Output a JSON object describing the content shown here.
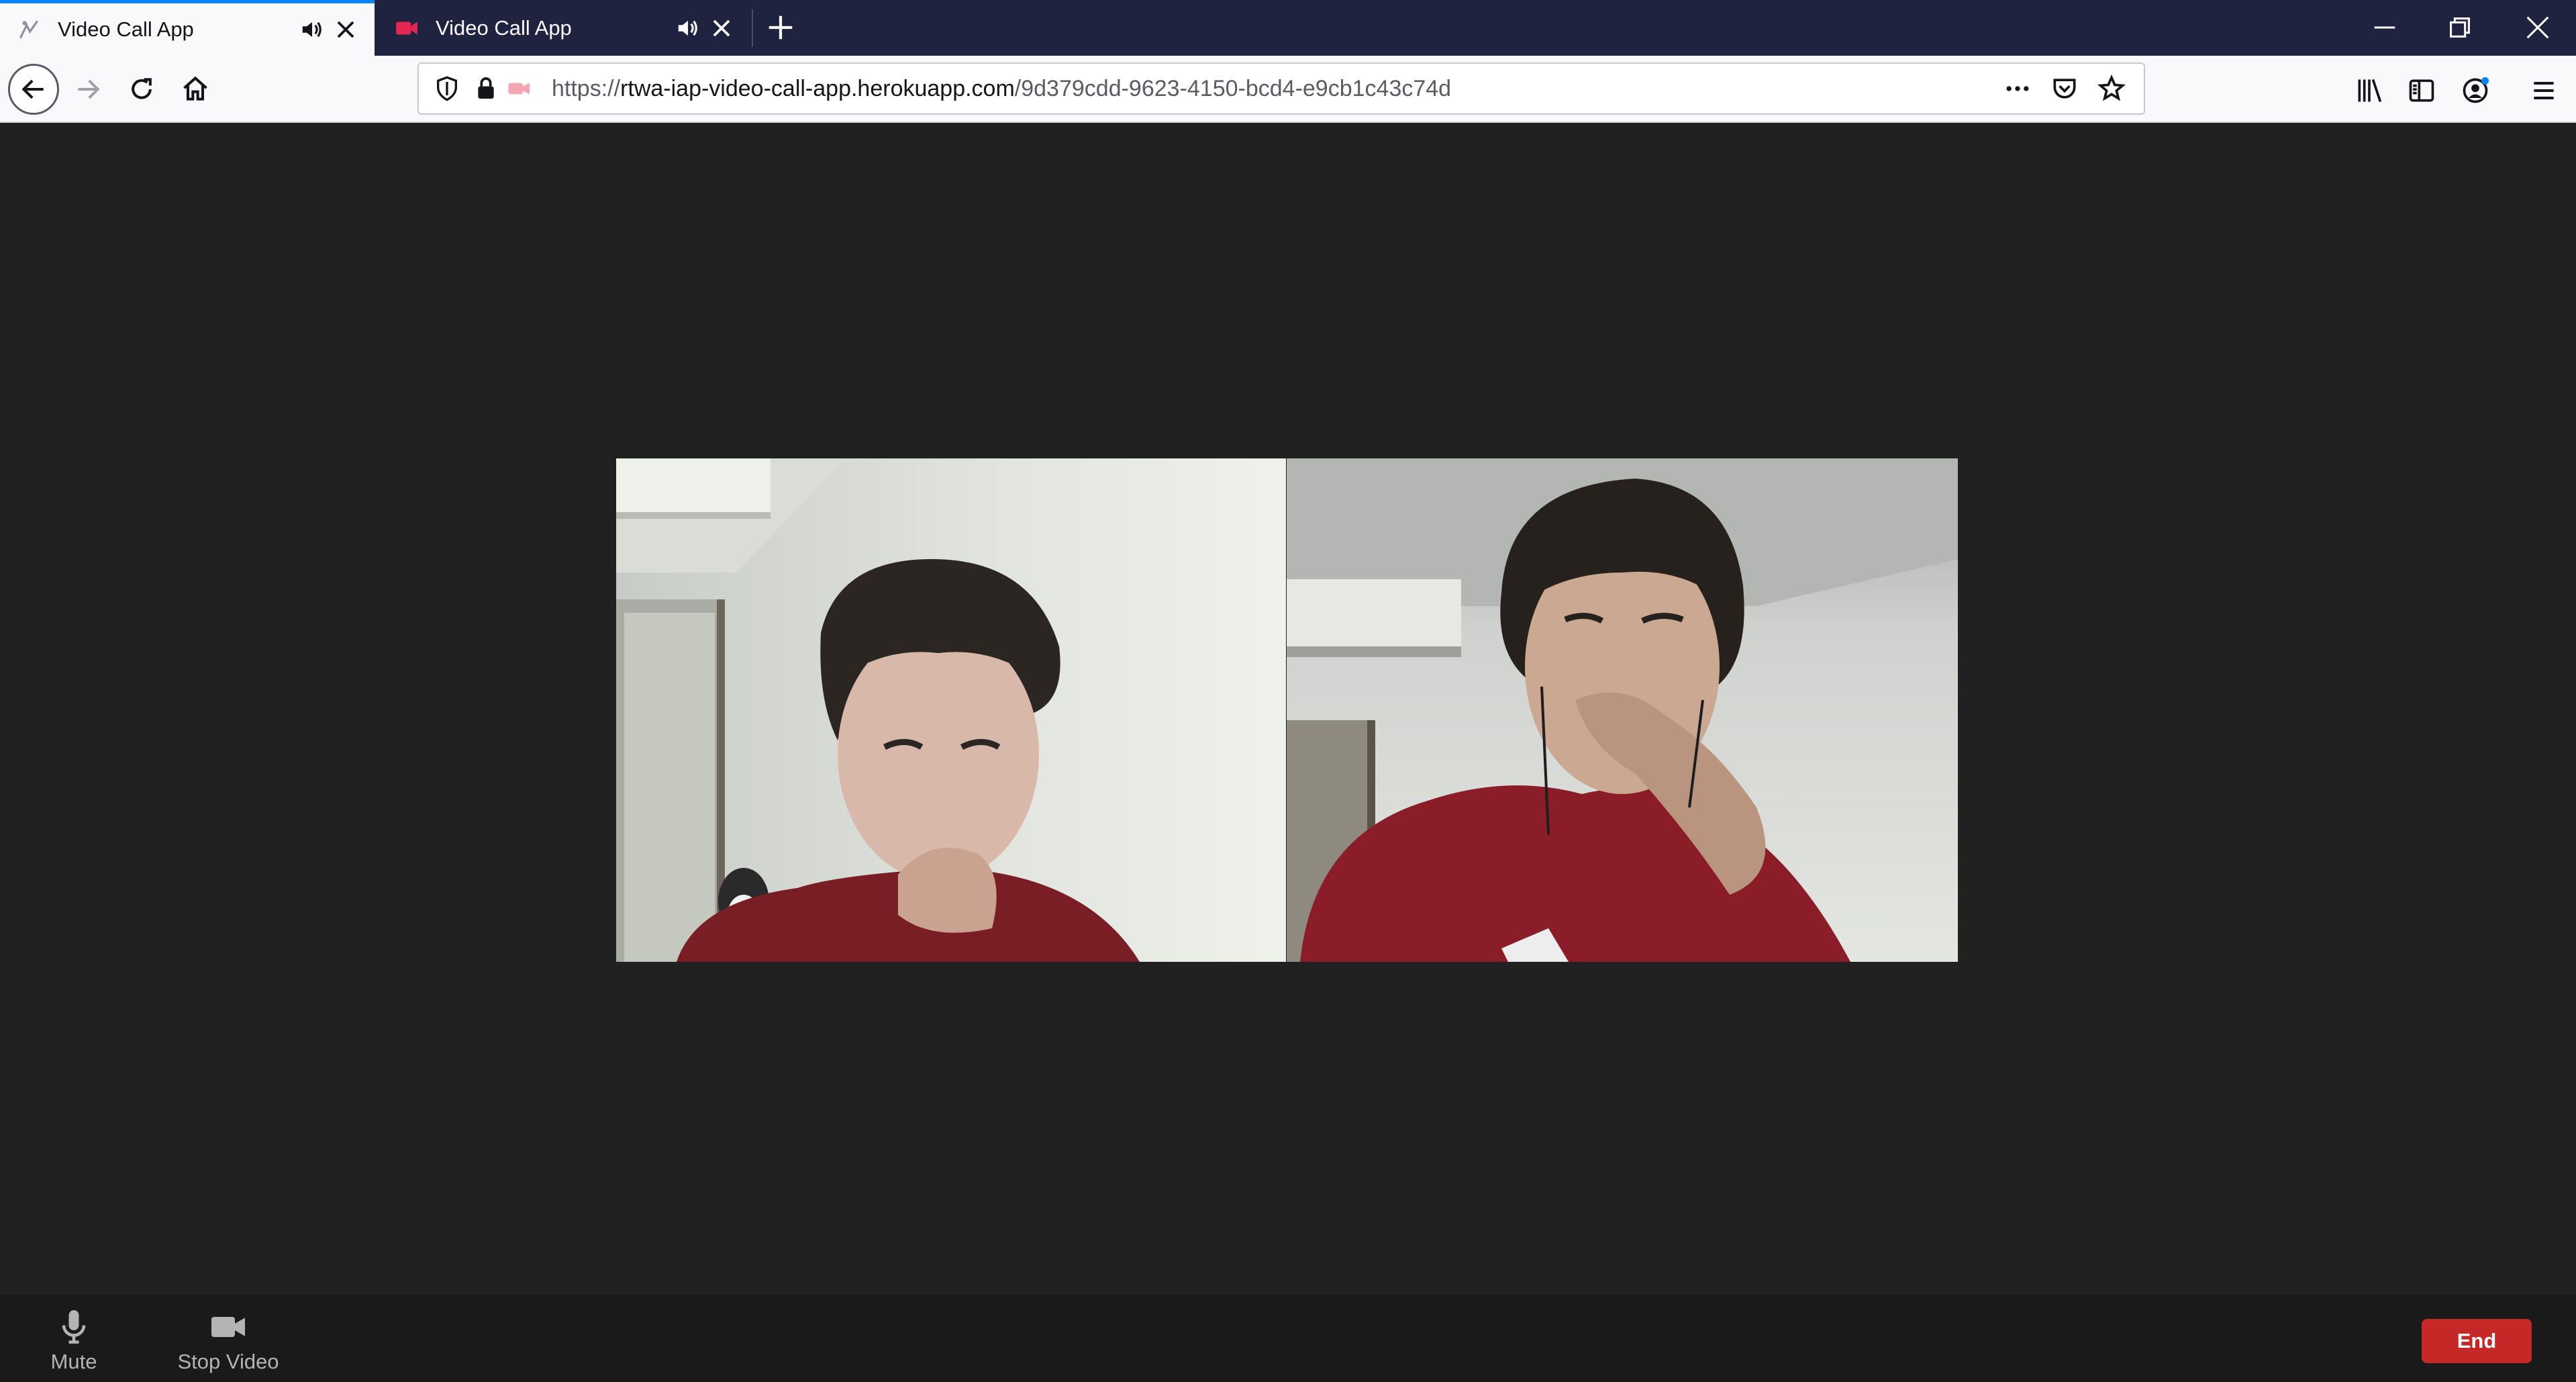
{
  "browser": {
    "tabs": [
      {
        "title": "Video Call App",
        "active": true
      },
      {
        "title": "Video Call App",
        "active": false
      }
    ],
    "url": {
      "scheme": "https://",
      "host": "rtwa-iap-video-call-app.herokuapp.com",
      "path": "/9d379cdd-9623-4150-bcd4-e9cb1c43c74d"
    }
  },
  "call": {
    "participants": [
      {
        "role": "local"
      },
      {
        "role": "remote"
      }
    ],
    "controls": {
      "mute_label": "Mute",
      "stop_video_label": "Stop Video",
      "end_label": "End"
    }
  },
  "colors": {
    "end_button": "#c62828",
    "tab_strip": "#202340",
    "active_tab_accent": "#0a84ff",
    "background": "#212121"
  },
  "icons": [
    "speaker-icon",
    "close-icon",
    "camera-icon",
    "plus-icon",
    "back-icon",
    "forward-icon",
    "reload-icon",
    "home-icon",
    "shield-icon",
    "lock-icon",
    "more-icon",
    "pocket-icon",
    "star-icon",
    "library-icon",
    "sidebar-icon",
    "account-icon",
    "menu-icon",
    "microphone-icon",
    "video-camera-icon"
  ]
}
